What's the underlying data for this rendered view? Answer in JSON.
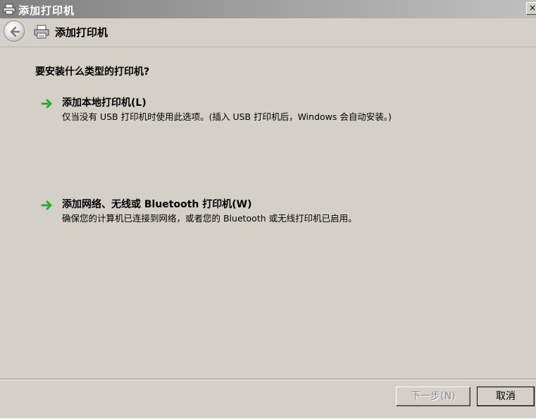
{
  "window": {
    "title": "添加打印机",
    "close_glyph": "×"
  },
  "nav": {
    "title": "添加打印机",
    "back_icon": "back-arrow-icon",
    "printer_icon": "printer-icon"
  },
  "content": {
    "question": "要安装什么类型的打印机?",
    "options": [
      {
        "title": "添加本地打印机(L)",
        "description": "仅当没有 USB 打印机时使用此选项。(插入 USB 打印机后，Windows 会自动安装。)"
      },
      {
        "title": "添加网络、无线或 Bluetooth 打印机(W)",
        "description": "确保您的计算机已连接到网络，或者您的 Bluetooth 或无线打印机已启用。"
      }
    ]
  },
  "footer": {
    "next_label": "下一步(N)",
    "cancel_label": "取消"
  },
  "colors": {
    "window_bg": "#d4d0c8",
    "arrow_green": "#2ea82e",
    "disabled_text": "#8c8c8c"
  }
}
